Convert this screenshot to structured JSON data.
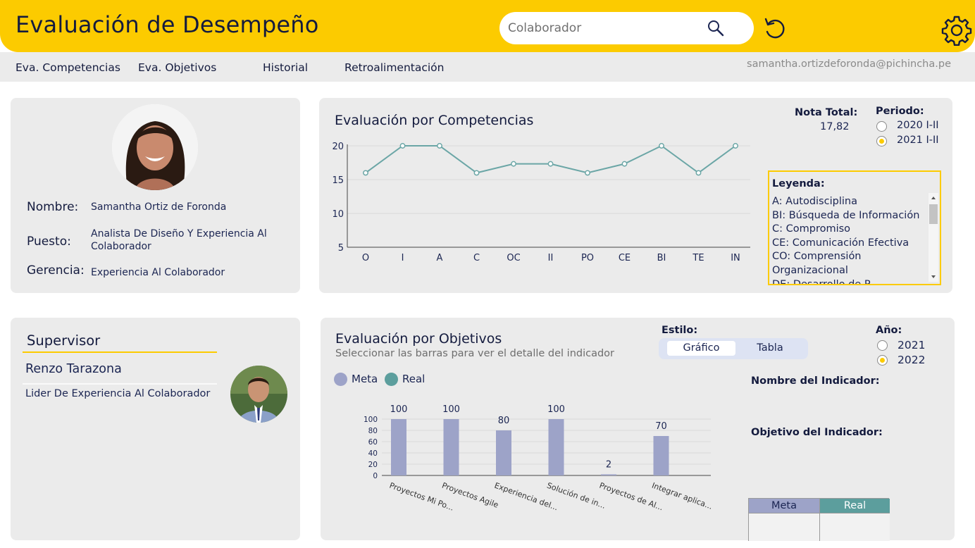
{
  "header": {
    "title": "Evaluación de Desempeño",
    "search_placeholder": "Colaborador"
  },
  "nav": {
    "tabs": [
      "Eva. Competencias",
      "Eva. Objetivos",
      "Historial",
      "Retroalimentación"
    ],
    "user_email": "samantha.ortizdeforonda@pichincha.pe"
  },
  "profile": {
    "name_label": "Nombre:",
    "name": "Samantha Ortiz de Foronda",
    "position_label": "Puesto:",
    "position": "Analista De Diseño Y Experiencia Al Colaborador",
    "management_label": "Gerencia:",
    "management": "Experiencia Al Colaborador"
  },
  "competencias": {
    "title": "Evaluación por Competencias",
    "total_label": "Nota Total:",
    "total_value": "17,82",
    "period_label": "Periodo:",
    "periods": [
      {
        "label": "2020 I-II",
        "selected": false
      },
      {
        "label": "2021 I-II",
        "selected": true
      }
    ],
    "legend_title": "Leyenda:",
    "legend_items": [
      "A: Autodisciplina",
      "BI: Búsqueda de Información",
      "C: Compromiso",
      "CE: Comunicación Efectiva",
      "CO: Comprensión Organizacional",
      "DE: Desarrollo de P..."
    ]
  },
  "supervisor": {
    "title": "Supervisor",
    "name": "Renzo Tarazona",
    "role": "Lider De Experiencia Al Colaborador"
  },
  "objetivos": {
    "title": "Evaluación por Objetivos",
    "subtitle": "Seleccionar las barras para ver el detalle del indicador",
    "style_label": "Estilo:",
    "style_options": [
      "Gráfico",
      "Tabla"
    ],
    "style_selected": "Gráfico",
    "year_label": "Año:",
    "years": [
      {
        "label": "2021",
        "selected": false
      },
      {
        "label": "2022",
        "selected": true
      }
    ],
    "indicator_name_label": "Nombre del Indicador:",
    "indicator_objective_label": "Objetivo del Indicador:",
    "table_headers": [
      "Meta",
      "Real"
    ]
  },
  "colors": {
    "accent": "#fccb00",
    "meta": "#9da3c8",
    "real": "#5c9e9d",
    "line": "#6ba6a6"
  },
  "icons": {
    "search": "search-icon",
    "refresh": "refresh-icon",
    "settings": "gear-icon"
  },
  "chart_data": [
    {
      "type": "line",
      "categories": [
        "O",
        "I",
        "A",
        "C",
        "OC",
        "II",
        "PO",
        "CE",
        "BI",
        "TE",
        "IN"
      ],
      "values": [
        16,
        20,
        20,
        16,
        17.33,
        17.33,
        16,
        17.33,
        20,
        16,
        20
      ],
      "ylim": [
        5,
        20
      ],
      "yticks": [
        5,
        10,
        15,
        20
      ],
      "grid": true
    },
    {
      "type": "bar",
      "categories": [
        "Proyectos Mi Po...",
        "Proyectos Agile",
        "Experiencia del...",
        "Solución de in...",
        "Proyectos de Al...",
        "Integrar aplica..."
      ],
      "series": [
        {
          "name": "Meta",
          "values": [
            100,
            100,
            80,
            100,
            2,
            70
          ]
        },
        {
          "name": "Real",
          "values": [
            0,
            0,
            0,
            0,
            0,
            0
          ]
        }
      ],
      "ylim": [
        0,
        100
      ],
      "yticks": [
        0,
        20,
        40,
        60,
        80,
        100
      ],
      "legend": "top-left",
      "grid": true
    }
  ]
}
